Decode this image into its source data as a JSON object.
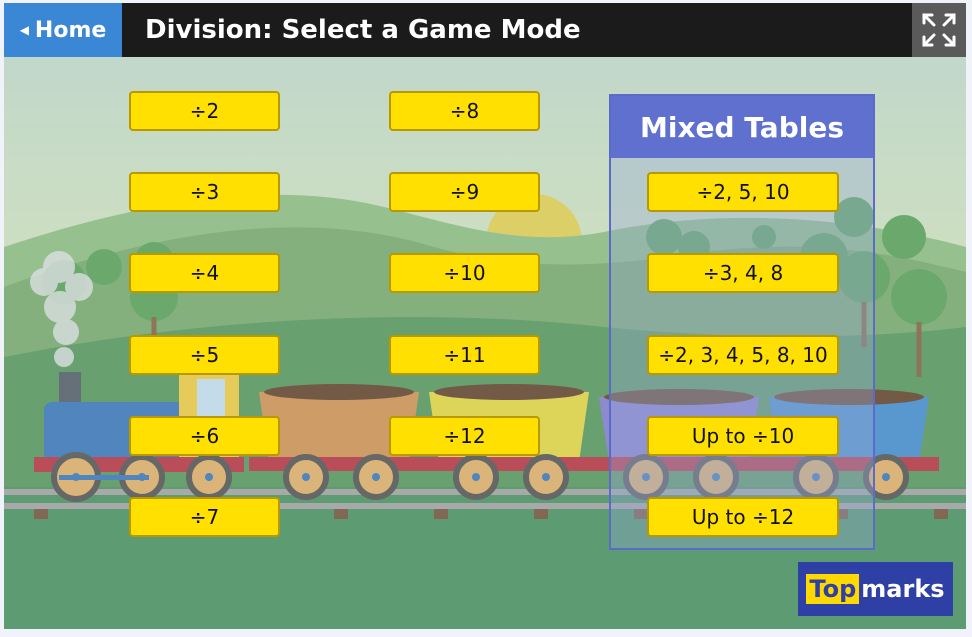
{
  "header": {
    "home_label": "Home",
    "title": "Division: Select a Game Mode",
    "fullscreen_icon": "fullscreen-icon"
  },
  "tables_col1": [
    "÷2",
    "÷3",
    "÷4",
    "÷5",
    "÷6",
    "÷7"
  ],
  "tables_col2": [
    "÷8",
    "÷9",
    "÷10",
    "÷11",
    "÷12"
  ],
  "mixed": {
    "title": "Mixed Tables",
    "items": [
      "÷2, 5, 10",
      "÷3, 4, 8",
      "÷2, 3, 4, 5, 8, 10",
      "Up to ÷10",
      "Up to ÷12"
    ]
  },
  "logo": {
    "part1": "Top",
    "part2": "marks"
  },
  "colors": {
    "button_yellow": "#ffe000",
    "home_blue": "#3a87d6",
    "panel_blue": "#5f70cf",
    "logo_blue": "#2e3fa5"
  }
}
